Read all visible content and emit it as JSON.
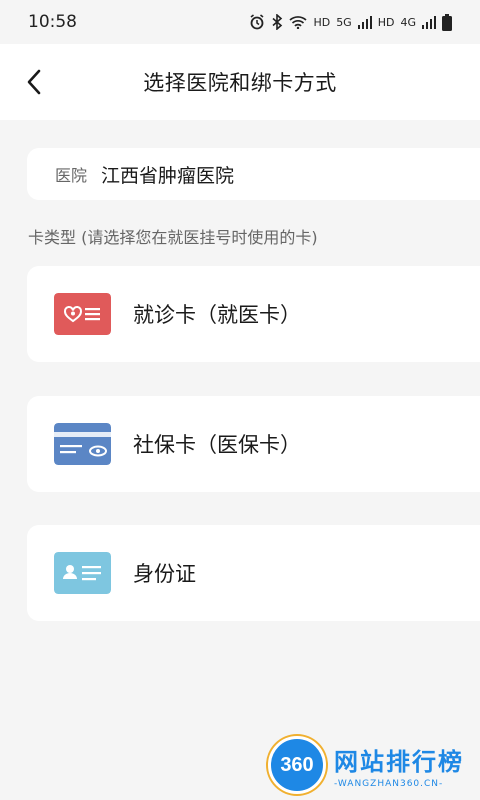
{
  "status_bar": {
    "time": "10:58",
    "network_labels": [
      "HD",
      "5G",
      "HD",
      "4G"
    ]
  },
  "nav": {
    "title": "选择医院和绑卡方式",
    "back_icon": "chevron-left-icon"
  },
  "hospital": {
    "label": "医院",
    "value": "江西省肿瘤医院"
  },
  "card_type_label": "卡类型 (请选择您在就医挂号时使用的卡)",
  "options": [
    {
      "label": "就诊卡（就医卡）",
      "icon": "medical-card-icon",
      "color": "#e05a5a"
    },
    {
      "label": "社保卡（医保卡）",
      "icon": "social-security-card-icon",
      "color": "#5b86c5"
    },
    {
      "label": "身份证",
      "icon": "id-card-icon",
      "color": "#7ec6e0"
    }
  ],
  "watermark": {
    "logo_text": "360",
    "name": "网站排行榜",
    "url": "-WANGZHAN360.CN-"
  }
}
